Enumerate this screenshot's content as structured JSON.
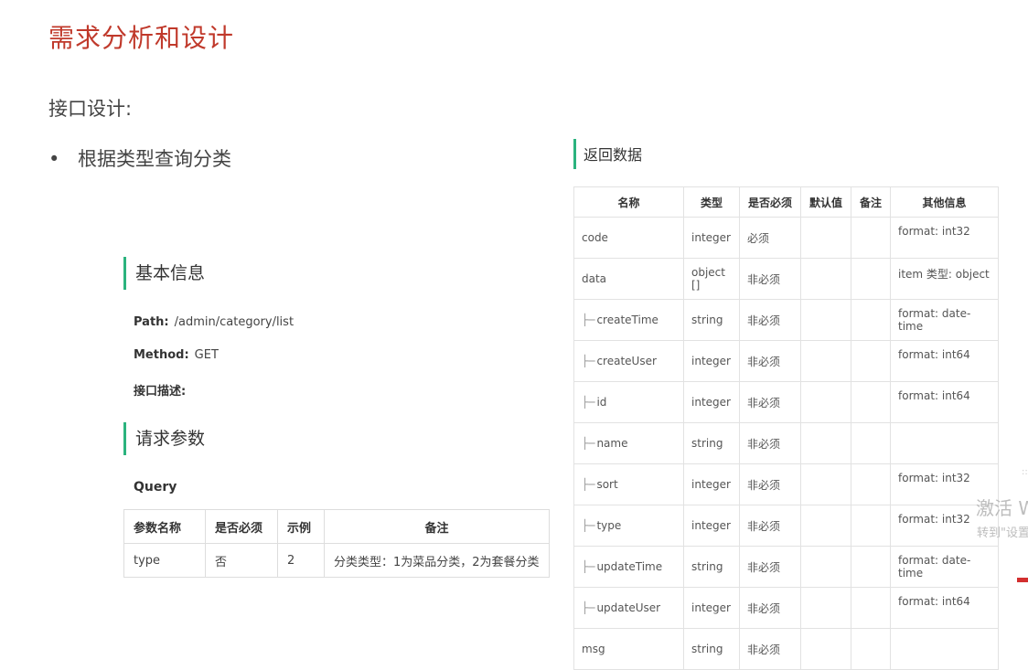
{
  "page": {
    "title": "需求分析和设计",
    "subtitle": "接口设计:",
    "bullet": "根据类型查询分类"
  },
  "basic": {
    "heading": "基本信息",
    "path_label": "Path:",
    "path_value": "/admin/category/list",
    "method_label": "Method:",
    "method_value": "GET",
    "desc_label": "接口描述:"
  },
  "request": {
    "heading": "请求参数",
    "query_label": "Query",
    "headers": [
      "参数名称",
      "是否必须",
      "示例",
      "备注"
    ],
    "rows": [
      [
        "type",
        "否",
        "2",
        "分类类型：1为菜品分类，2为套餐分类"
      ]
    ]
  },
  "response": {
    "heading": "返回数据",
    "headers": [
      "名称",
      "类型",
      "是否必须",
      "默认值",
      "备注",
      "其他信息"
    ],
    "rows": [
      {
        "name": "code",
        "type": "integer",
        "required": "必须",
        "default": "",
        "note": "",
        "info": "format: int32",
        "child": false
      },
      {
        "name": "data",
        "type": "object []",
        "required": "非必须",
        "default": "",
        "note": "",
        "info": "item 类型: object",
        "child": false
      },
      {
        "name": "createTime",
        "type": "string",
        "required": "非必须",
        "default": "",
        "note": "",
        "info": "format: date-time",
        "child": true
      },
      {
        "name": "createUser",
        "type": "integer",
        "required": "非必须",
        "default": "",
        "note": "",
        "info": "format: int64",
        "child": true
      },
      {
        "name": "id",
        "type": "integer",
        "required": "非必须",
        "default": "",
        "note": "",
        "info": "format: int64",
        "child": true
      },
      {
        "name": "name",
        "type": "string",
        "required": "非必须",
        "default": "",
        "note": "",
        "info": "",
        "child": true
      },
      {
        "name": "sort",
        "type": "integer",
        "required": "非必须",
        "default": "",
        "note": "",
        "info": "format: int32",
        "child": true
      },
      {
        "name": "type",
        "type": "integer",
        "required": "非必须",
        "default": "",
        "note": "",
        "info": "format: int32",
        "child": true
      },
      {
        "name": "updateTime",
        "type": "string",
        "required": "非必须",
        "default": "",
        "note": "",
        "info": "format: date-time",
        "child": true
      },
      {
        "name": "updateUser",
        "type": "integer",
        "required": "非必须",
        "default": "",
        "note": "",
        "info": "format: int64",
        "child": true
      },
      {
        "name": "msg",
        "type": "string",
        "required": "非必须",
        "default": "",
        "note": "",
        "info": "",
        "child": false
      }
    ]
  },
  "watermark": {
    "line1": "激活 W",
    "line2": "转到\"设置",
    "tiny": "::"
  }
}
